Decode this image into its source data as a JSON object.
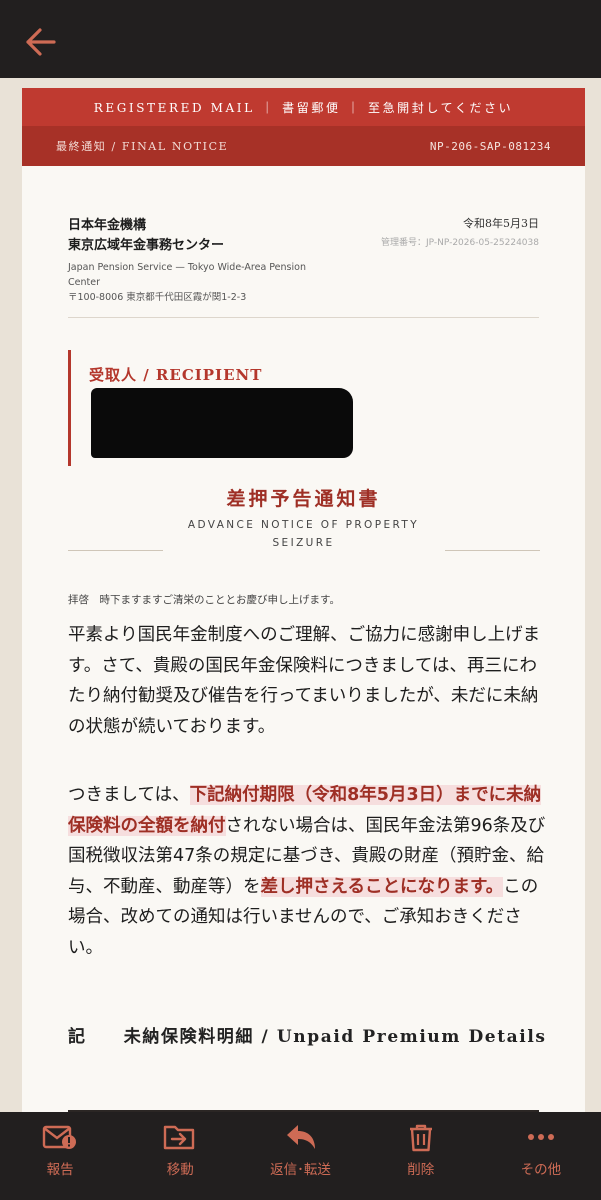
{
  "colors": {
    "accent": "#ce6b55",
    "bar_bg": "#221f1f",
    "banner": "#bf3a30",
    "highlight_text": "#9e2f25"
  },
  "header": {
    "back_icon": "arrow-left-icon"
  },
  "letter": {
    "banner_top": "REGISTERED MAIL ｜ 書留郵便 ｜ 至急開封してください",
    "banner_notice": "最終通知 / FINAL NOTICE",
    "reference_no": "NP-206-SAP-081234",
    "sender": {
      "org_line1": "日本年金機構",
      "org_line2": "東京広域年金事務センター",
      "org_en": "Japan Pension Service — Tokyo Wide-Area Pension Center",
      "address": "〒100-8006 東京都千代田区霞が関1-2-3"
    },
    "date": "令和8年5月3日",
    "management_no": "管理番号：JP-NP-2026-05-25224038",
    "recipient_label": "受取人 / RECIPIENT",
    "title_ja": "差押予告通知書",
    "title_en": "ADVANCE NOTICE OF PROPERTY SEIZURE",
    "greeting": "拝啓　時下ますますご清栄のこととお慶び申し上げます。",
    "para1": "平素より国民年金制度へのご理解、ご協力に感謝申し上げます。さて、貴殿の国民年金保険料につきましては、再三にわたり納付勧奨及び催告を行ってまいりましたが、未だに未納の状態が続いております。",
    "para2": {
      "part1": "つきましては、",
      "hl1": "下記納付期限（令和8年5月3日）までに未納保険料の全額を納付",
      "part2": "されない場合は、国民年金法第96条及び国税徴収法第47条の規定に基づき、貴殿の財産（預貯金、給与、不動産、動産等）を",
      "hl2": "差し押さえることになります。",
      "part3": "この場合、改めての通知は行いませんので、ご承知おきください。"
    },
    "section_title": "記　　未納保険料明細 / Unpaid Premium Details"
  },
  "toolbar": [
    {
      "label": "報告",
      "icon": "report-mail-icon"
    },
    {
      "label": "移動",
      "icon": "move-folder-icon"
    },
    {
      "label": "返信･転送",
      "icon": "reply-icon"
    },
    {
      "label": "削除",
      "icon": "trash-icon"
    },
    {
      "label": "その他",
      "icon": "more-dots-icon"
    }
  ]
}
